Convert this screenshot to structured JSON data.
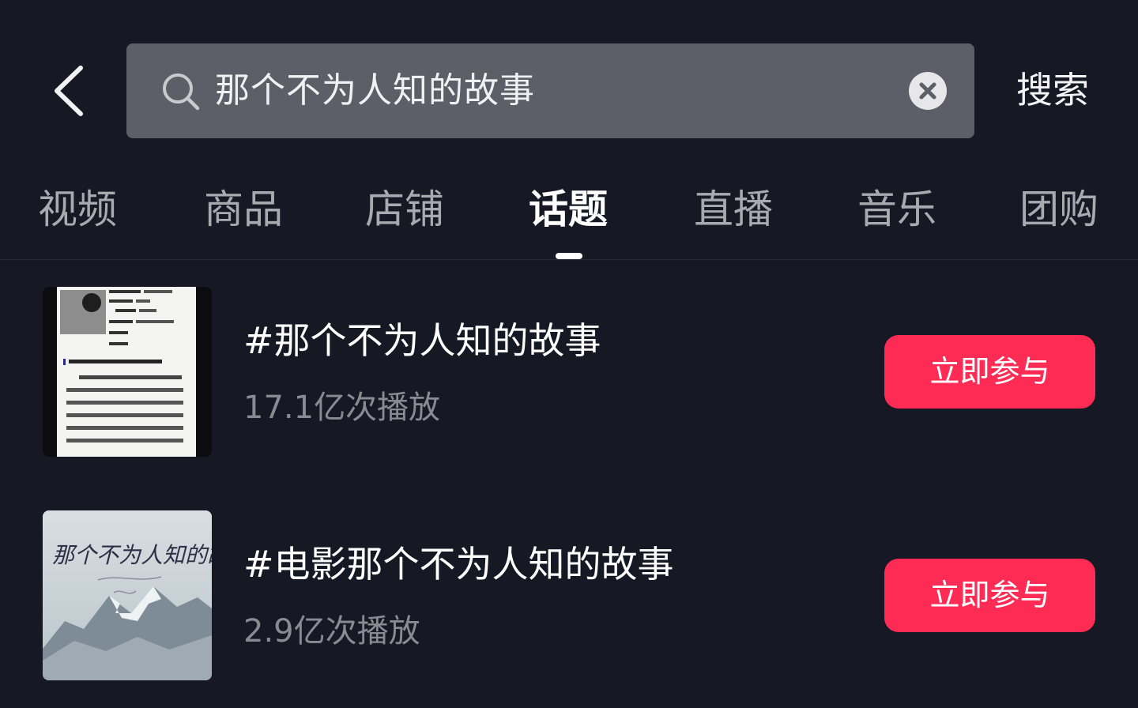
{
  "header": {
    "back_icon": "chevron-left-icon",
    "search": {
      "icon": "search-icon",
      "value": "那个不为人知的故事",
      "clear_icon": "clear-icon"
    },
    "search_button_label": "搜索"
  },
  "tabs": [
    {
      "label": "视频",
      "active": false
    },
    {
      "label": "商品",
      "active": false
    },
    {
      "label": "店铺",
      "active": false
    },
    {
      "label": "话题",
      "active": true
    },
    {
      "label": "直播",
      "active": false
    },
    {
      "label": "音乐",
      "active": false
    },
    {
      "label": "团购",
      "active": false
    }
  ],
  "results": [
    {
      "title": "#那个不为人知的故事",
      "plays": "17.1亿次播放",
      "button_label": "立即参与"
    },
    {
      "title": "#电影那个不为人知的故事",
      "plays": "2.9亿次播放",
      "button_label": "立即参与",
      "thumbnail_text": "那个不为人知的故事"
    }
  ],
  "colors": {
    "background": "#161823",
    "search_box": "#5d5e67",
    "accent": "#fe2c55",
    "muted_text": "#8a8b92"
  }
}
